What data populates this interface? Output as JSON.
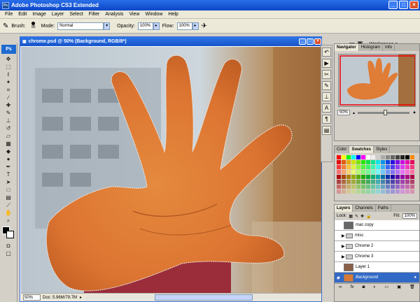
{
  "app": {
    "title": "Adobe Photoshop CS3 Extended",
    "icon": "Ps"
  },
  "window_buttons": {
    "minimize": "_",
    "maximize": "□",
    "close": "×"
  },
  "menu": [
    "File",
    "Edit",
    "Image",
    "Layer",
    "Select",
    "Filter",
    "Analysis",
    "View",
    "Window",
    "Help"
  ],
  "options": {
    "brush_label": "Brush:",
    "brush_size": "90",
    "mode_label": "Mode:",
    "mode_value": "Normal",
    "opacity_label": "Opacity:",
    "opacity_value": "100%",
    "flow_label": "Flow:",
    "flow_value": "100%",
    "workspace_label": "Workspace ▾"
  },
  "toolbox_logo": "Ps",
  "document": {
    "title": "chrome.psd @ 50% (Background, RGB/8*)",
    "zoom": "50%",
    "doc_info": "Doc: 5.96M/79.7M"
  },
  "navigator": {
    "tabs": [
      "Navigator",
      "Histogram",
      "Info"
    ],
    "zoom": "50%",
    "zoom_level": 0.5
  },
  "color_panel": {
    "tabs": [
      "Color",
      "Swatches",
      "Styles"
    ]
  },
  "layers_panel": {
    "tabs": [
      "Layers",
      "Channels",
      "Paths"
    ],
    "lock_label": "Lock:",
    "fill_label": "Fill:",
    "fill_value": "100%",
    "layers": [
      {
        "name": "mac copy",
        "type": "layer"
      },
      {
        "name": "misc",
        "type": "folder"
      },
      {
        "name": "Chrome 2",
        "type": "folder"
      },
      {
        "name": "Chrome 3",
        "type": "folder"
      },
      {
        "name": "Layer 1",
        "type": "layer"
      },
      {
        "name": "Background",
        "type": "layer",
        "selected": true
      }
    ]
  },
  "colors": {
    "title_blue": "#0a46c8",
    "selection": "#3169c6",
    "skin": "#e8893f"
  }
}
